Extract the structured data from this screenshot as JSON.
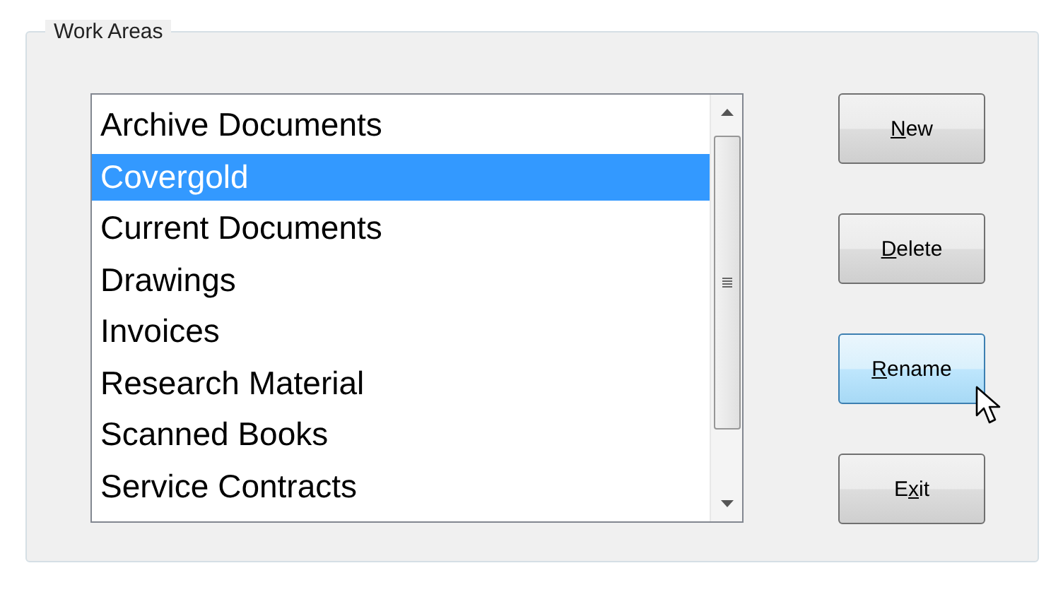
{
  "group": {
    "title": "Work Areas"
  },
  "list": {
    "items": [
      {
        "label": "Archive Documents",
        "selected": false
      },
      {
        "label": "Covergold",
        "selected": true
      },
      {
        "label": "Current Documents",
        "selected": false
      },
      {
        "label": "Drawings",
        "selected": false
      },
      {
        "label": "Invoices",
        "selected": false
      },
      {
        "label": "Research Material",
        "selected": false
      },
      {
        "label": "Scanned Books",
        "selected": false
      },
      {
        "label": "Service Contracts",
        "selected": false
      }
    ]
  },
  "buttons": [
    {
      "access_key": "N",
      "after": "ew",
      "hovered": false
    },
    {
      "access_key": "D",
      "after": "elete",
      "hovered": false
    },
    {
      "access_key": "R",
      "after": "ename",
      "hovered": true
    },
    {
      "before": "E",
      "access_key": "x",
      "after": "it",
      "hovered": false
    }
  ]
}
